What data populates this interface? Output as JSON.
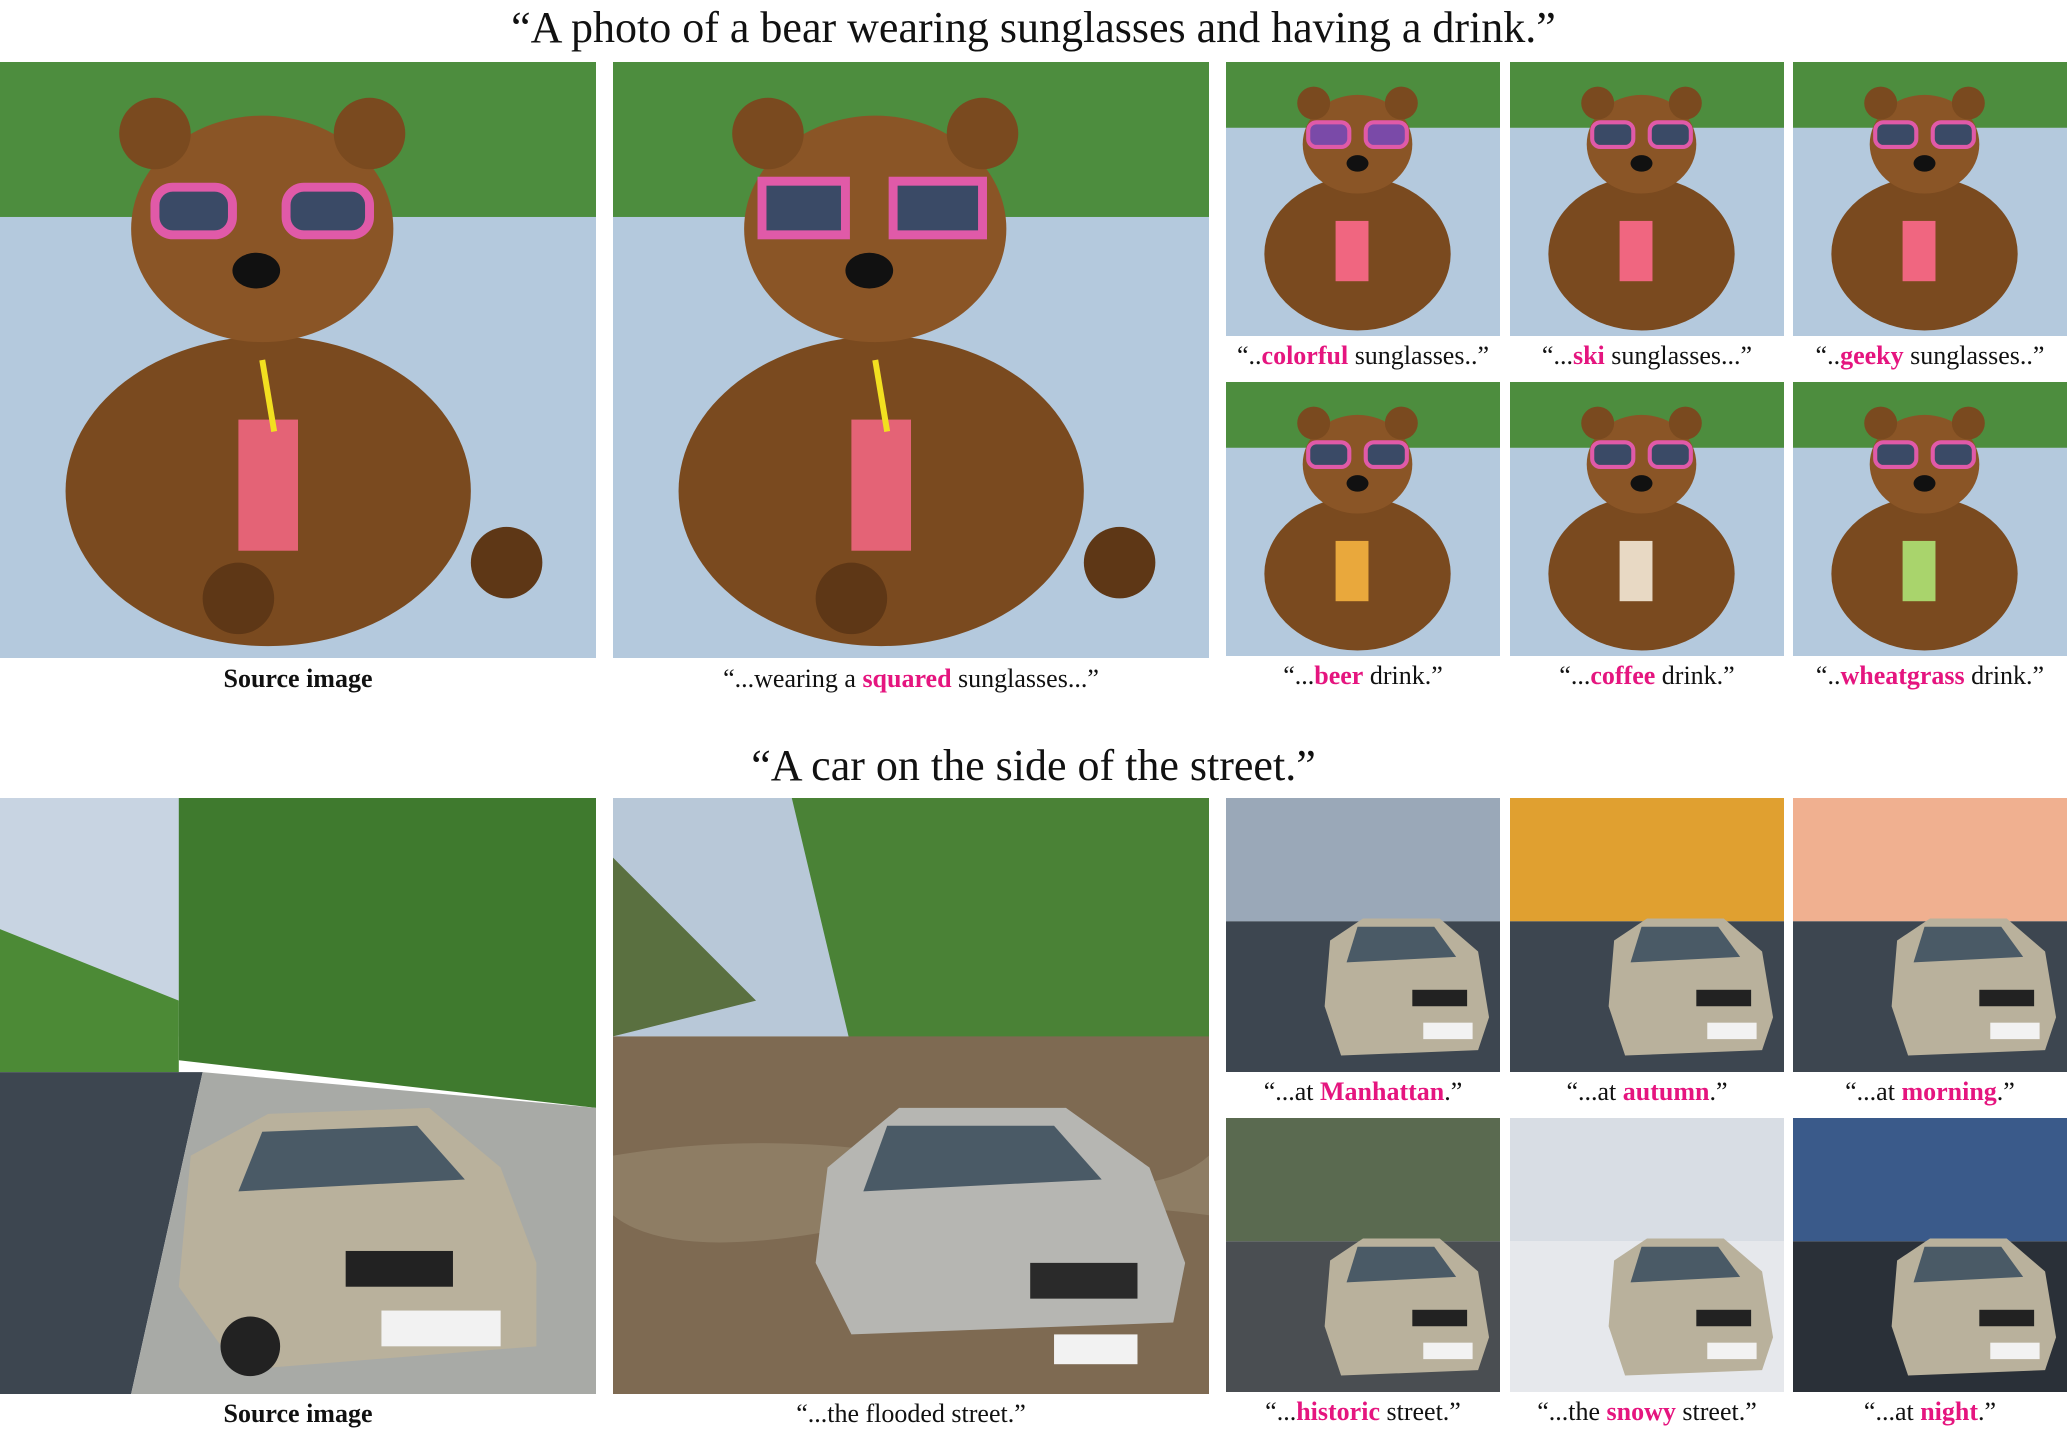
{
  "section1": {
    "title": "“A photo of a bear wearing sunglasses and having a drink.”",
    "source_caption": "Source image",
    "main_caption": {
      "pre": "“...wearing a ",
      "hl": "squared",
      "post": " sunglasses...”"
    },
    "grid": [
      {
        "pre": "“..",
        "hl": "colorful",
        "post": " sunglasses..”"
      },
      {
        "pre": "“...",
        "hl": "ski",
        "post": " sunglasses...”"
      },
      {
        "pre": "“..",
        "hl": "geeky",
        "post": " sunglasses..”"
      },
      {
        "pre": "“...",
        "hl": "beer",
        "post": " drink.”"
      },
      {
        "pre": "“...",
        "hl": "coffee",
        "post": " drink.”"
      },
      {
        "pre": "“..",
        "hl": "wheatgrass",
        "post": " drink.”"
      }
    ]
  },
  "section2": {
    "title": "“A car on the side of the street.”",
    "source_caption": "Source image",
    "main_caption": {
      "text": "“...the flooded street.”"
    },
    "grid": [
      {
        "pre": "“...at ",
        "hl": "Manhattan",
        "post": ".”"
      },
      {
        "pre": "“...at ",
        "hl": "autumn",
        "post": ".”"
      },
      {
        "pre": "“...at ",
        "hl": "morning",
        "post": ".”"
      },
      {
        "pre": "“...",
        "hl": "historic",
        "post": " street.”"
      },
      {
        "pre": "“...the ",
        "hl": "snowy",
        "post": " street.”"
      },
      {
        "pre": "“...at ",
        "hl": "night",
        "post": ".”"
      }
    ]
  },
  "colors": {
    "highlight": "#e5157f"
  }
}
